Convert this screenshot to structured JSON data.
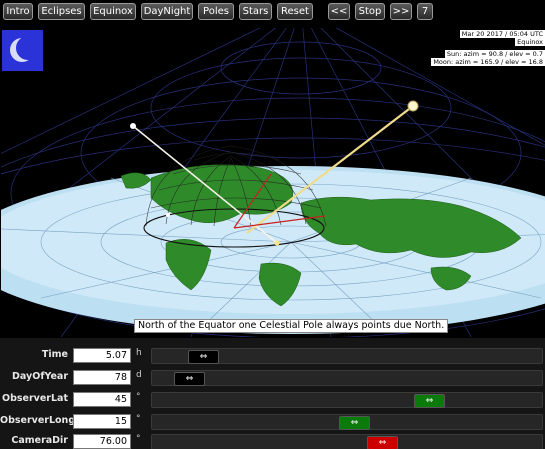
{
  "toolbar": {
    "buttons": [
      {
        "label": "Intro"
      },
      {
        "label": "Eclipses"
      },
      {
        "label": "Equinox"
      },
      {
        "label": "DayNight"
      },
      {
        "label": "Poles"
      },
      {
        "label": "Stars"
      },
      {
        "label": "Reset"
      },
      {
        "label": "<<"
      },
      {
        "label": "Stop"
      },
      {
        "label": ">>"
      },
      {
        "label": "7"
      }
    ]
  },
  "scene": {
    "info": {
      "datetime": "Mar 20 2017 / 05:04 UTC",
      "event": "Equinox",
      "sun": "Sun: azim = 90.8 / elev = 0.7",
      "moon": "Moon: azim = 165.9 / elev = 16.8"
    },
    "caption": "North of the Equator one Celestial Pole always points due North.",
    "moon_icon": "crescent-moon-icon"
  },
  "controls": [
    {
      "label": "Time",
      "value": "5.07",
      "unit": "h",
      "fraction": 0.1,
      "thumb_color": "#000000",
      "thumb_glyph": "⇔"
    },
    {
      "label": "DayOfYear",
      "value": "78",
      "unit": "d",
      "fraction": 0.06,
      "thumb_color": "#000000",
      "thumb_glyph": "⇔"
    },
    {
      "label": "ObserverLat",
      "value": "45",
      "unit": "°",
      "fraction": 0.73,
      "thumb_color": "#0a7a0a",
      "thumb_glyph": "⇔"
    },
    {
      "label": "ObserverLong",
      "value": "15",
      "unit": "°",
      "fraction": 0.52,
      "thumb_color": "#0a7a0a",
      "thumb_glyph": "⇔"
    },
    {
      "label": "CameraDir",
      "value": "76.00",
      "unit": "°",
      "fraction": 0.6,
      "thumb_color": "#cc0000",
      "thumb_glyph": "⇔"
    }
  ]
}
